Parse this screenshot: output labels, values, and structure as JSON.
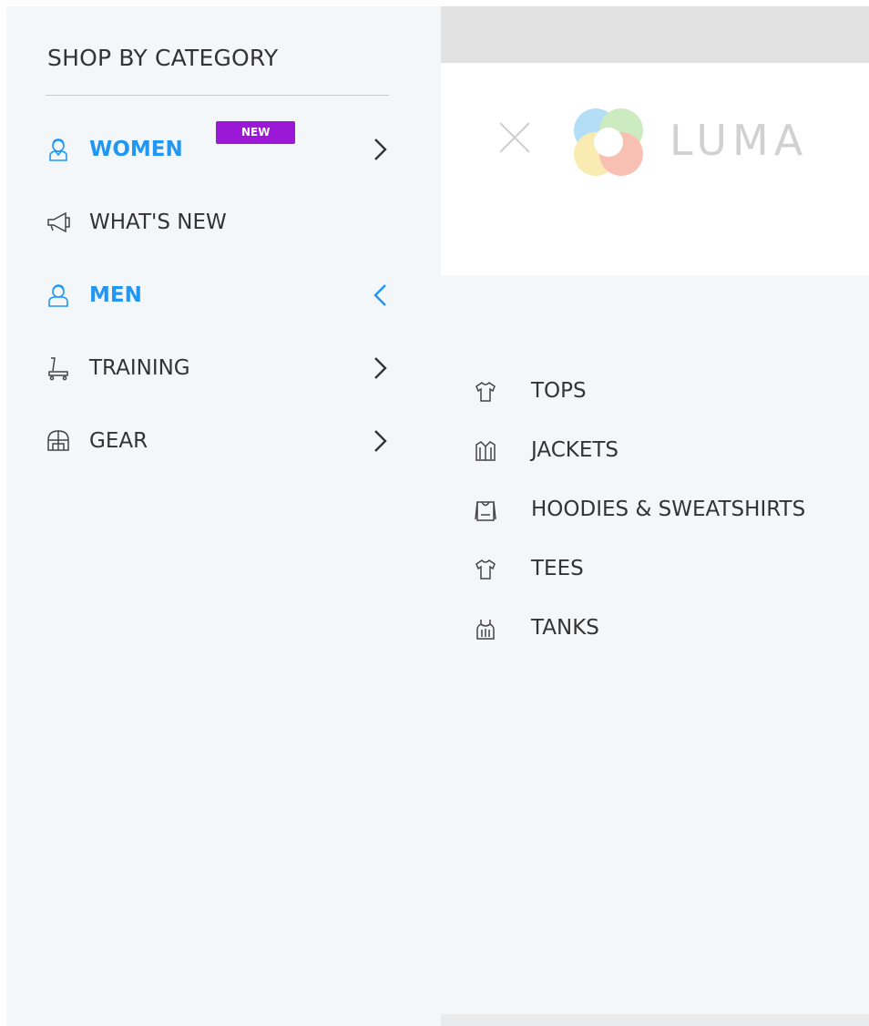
{
  "sidebar": {
    "title": "SHOP BY CATEGORY",
    "categories": [
      {
        "label": "WOMEN",
        "icon": "woman-icon",
        "badge": "NEW",
        "active": true,
        "chevron": "chevron-right-icon"
      },
      {
        "label": "WHAT'S NEW",
        "icon": "megaphone-icon",
        "active": false
      },
      {
        "label": "MEN",
        "icon": "man-icon",
        "active": true,
        "chevron": "chevron-left-icon"
      },
      {
        "label": "TRAINING",
        "icon": "treadmill-icon",
        "active": false,
        "chevron": "chevron-right-icon"
      },
      {
        "label": "GEAR",
        "icon": "gear-bag-icon",
        "active": false,
        "chevron": "chevron-right-icon"
      }
    ]
  },
  "header": {
    "logo_text": "LUMA",
    "close_icon": "close-icon",
    "logo_icon": "luma-logo-icon"
  },
  "submenu": {
    "items": [
      {
        "label": "TOPS",
        "icon": "tshirt-icon"
      },
      {
        "label": "JACKETS",
        "icon": "jacket-icon"
      },
      {
        "label": "HOODIES & SWEATSHIRTS",
        "icon": "hoodie-icon"
      },
      {
        "label": "TEES",
        "icon": "tshirt-icon"
      },
      {
        "label": "TANKS",
        "icon": "tank-top-icon"
      }
    ]
  },
  "colors": {
    "accent": "#2196f3",
    "badge": "#9a18d6",
    "text": "#333333",
    "panel_bg": "#f4f7fa"
  }
}
